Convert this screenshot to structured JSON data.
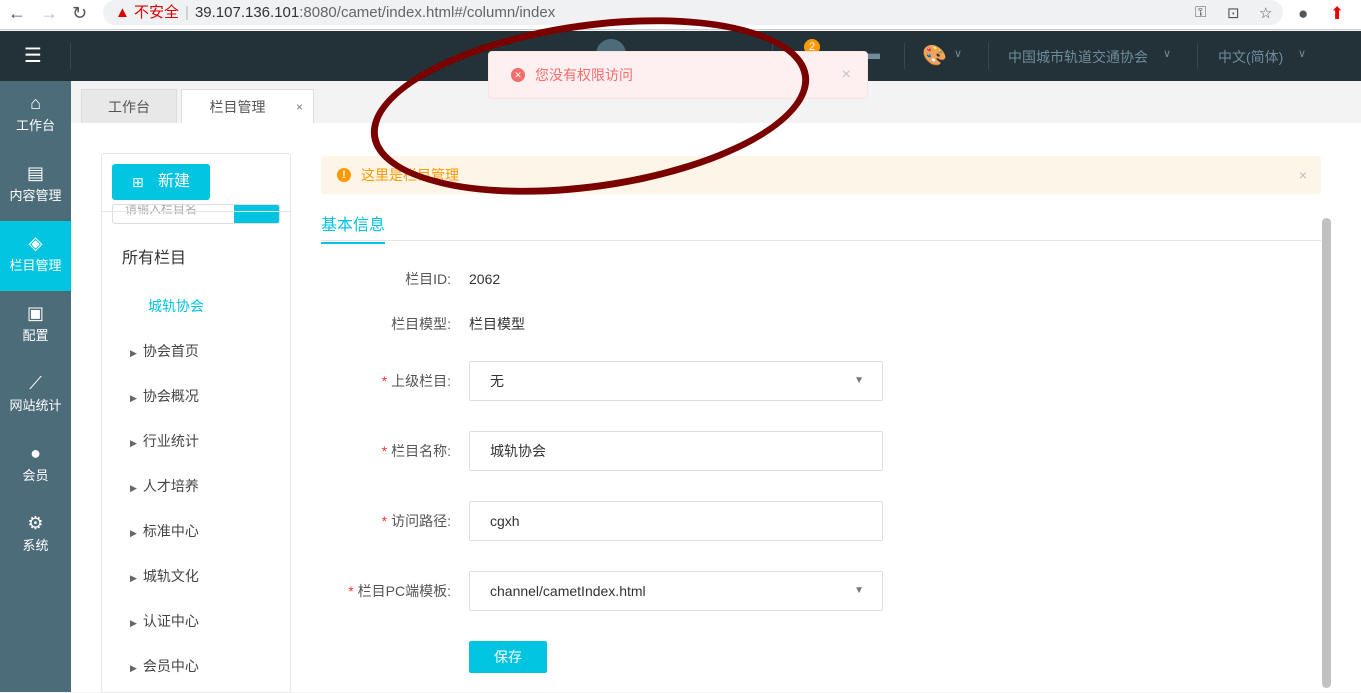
{
  "browser": {
    "insecure_label": "不安全",
    "url_host": "39.107.136.101",
    "url_rest": ":8080/camet/index.html#/column/index"
  },
  "topbar": {
    "badge": "2",
    "org": "中国城市轨道交通协会",
    "lang": "中文(简体)"
  },
  "sidebar": [
    {
      "icon": "home-icon",
      "label": "工作台"
    },
    {
      "icon": "content-icon",
      "label": "内容管理"
    },
    {
      "icon": "layers-icon",
      "label": "栏目管理"
    },
    {
      "icon": "box-icon",
      "label": "配置"
    },
    {
      "icon": "chart-icon",
      "label": "网站统计"
    },
    {
      "icon": "user-icon",
      "label": "会员"
    },
    {
      "icon": "gear-icon",
      "label": "系统"
    }
  ],
  "tabs": [
    {
      "label": "工作台"
    },
    {
      "label": "栏目管理"
    }
  ],
  "toast": {
    "message": "您没有权限访问"
  },
  "tree": {
    "new_label": "新建",
    "search_placeholder": "请输入栏目名",
    "root": "所有栏目",
    "selected": "城轨协会",
    "items": [
      "协会首页",
      "协会概况",
      "行业统计",
      "人才培养",
      "标准中心",
      "城轨文化",
      "认证中心",
      "会员中心"
    ]
  },
  "alert": {
    "message": "这里是栏目管理"
  },
  "form": {
    "tab": "基本信息",
    "id_label": "栏目ID:",
    "id_value": "2062",
    "model_label": "栏目模型:",
    "model_value": "栏目模型",
    "parent_label": "上级栏目:",
    "parent_value": "无",
    "name_label": "栏目名称:",
    "name_value": "城轨协会",
    "path_label": "访问路径:",
    "path_value": "cgxh",
    "template_label": "栏目PC端模板:",
    "template_value": "channel/cametIndex.html",
    "save_label": "保存"
  }
}
